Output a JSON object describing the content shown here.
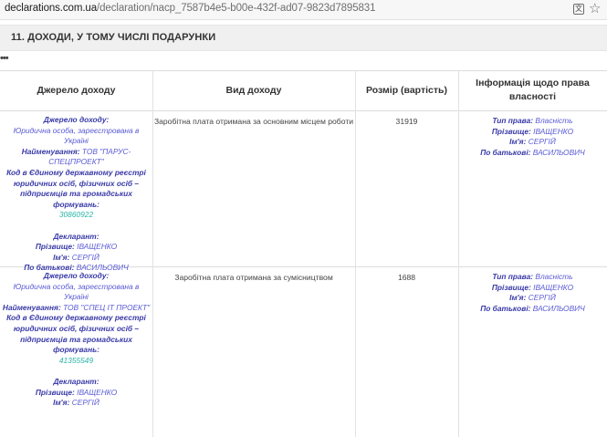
{
  "browser": {
    "url_domain": "declarations.com.ua",
    "url_path": "/declaration/nacp_7587b4e5-b00e-432f-ad07-9823d7895831"
  },
  "section": {
    "title": "11.   ДОХОДИ, У ТОМУ ЧИСЛІ ПОДАРУНКИ"
  },
  "more_glyph": "•••",
  "table": {
    "headers": {
      "source": "Джерело доходу",
      "type": "Вид доходу",
      "amount": "Розмір (вартість)",
      "ownership": "Інформація щодо права власності"
    },
    "labels": {
      "source": "Джерело доходу:",
      "name": "Найменування:",
      "code": "Код в Єдиному державному реєстрі юридичних осіб, фізичних осіб – підприємців та громадських формувань:",
      "declarant": "Декларант:",
      "surname": "Прізвище:",
      "first_name": "Ім'я:",
      "patronymic": "По батькові:",
      "right_type": "Тип права:"
    },
    "rows": [
      {
        "source_value": "Юридична особа, зареєстрована в Україні",
        "name_value": "ТОВ \"ПАРУС-СПЕЦПРОЕКТ\"",
        "code_value": "30860922",
        "surname_value": "ІВАЩЕНКО",
        "first_name_value": "СЕРГІЙ",
        "patronymic_value": "ВАСИЛЬОВИЧ",
        "income_type": "Заробітна плата отримана за основним місцем роботи",
        "amount": "31919",
        "right_type_value": "Власність",
        "owner_surname": "ІВАЩЕНКО",
        "owner_first_name": "СЕРГІЙ",
        "owner_patronymic": "ВАСИЛЬОВИЧ"
      },
      {
        "source_value": "Юридична особа, зареєстрована в Україні",
        "name_value": "ТОВ \"СПЕЦ ІТ ПРОЕКТ\"",
        "code_value": "41355549",
        "surname_value": "ІВАЩЕНКО",
        "first_name_value": "СЕРГІЙ",
        "patronymic_value": "",
        "income_type": "Заробітна плата отримана за сумісництвом",
        "amount": "1688",
        "right_type_value": "Власність",
        "owner_surname": "ІВАЩЕНКО",
        "owner_first_name": "СЕРГІЙ",
        "owner_patronymic": "ВАСИЛЬОВИЧ"
      }
    ]
  },
  "icons": {
    "translate": "translate-icon",
    "bookmark": "star-icon",
    "more": "more-icon"
  }
}
